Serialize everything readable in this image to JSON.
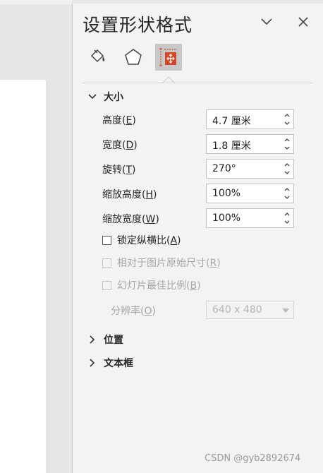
{
  "pane": {
    "title": "设置形状格式",
    "tabs": [
      {
        "name": "fill-line",
        "icon": "paint-bucket-icon"
      },
      {
        "name": "effects",
        "icon": "pentagon-icon"
      },
      {
        "name": "size-properties",
        "icon": "size-position-icon",
        "selected": true
      }
    ]
  },
  "size_section": {
    "header": "大小",
    "height": {
      "label": "高度(",
      "key": "E",
      "close": ")",
      "value": "4.7 厘米"
    },
    "width": {
      "label": "宽度(",
      "key": "D",
      "close": ")",
      "value": "1.8 厘米"
    },
    "rotation": {
      "label": "旋转(",
      "key": "T",
      "close": ")",
      "value": "270°"
    },
    "scale_height": {
      "label": "缩放高度(",
      "key": "H",
      "close": ")",
      "value": "100%"
    },
    "scale_width": {
      "label": "缩放宽度(",
      "key": "W",
      "close": ")",
      "value": "100%"
    },
    "lock_aspect": {
      "label": "锁定纵横比(",
      "key": "A",
      "close": ")"
    },
    "relative_original": {
      "label": "相对于图片原始尺寸(",
      "key": "R",
      "close": ")"
    },
    "best_scale": {
      "label": "幻灯片最佳比例(",
      "key": "B",
      "close": ")"
    },
    "resolution": {
      "label": "分辨率(",
      "key": "O",
      "close": ")",
      "value": "640 x 480"
    }
  },
  "position_section": {
    "header": "位置"
  },
  "textbox_section": {
    "header": "文本框"
  },
  "watermark": "CSDN @gyb2892674",
  "colors": {
    "accent": "#d24726",
    "selected_tab": "#c8c8c8"
  }
}
